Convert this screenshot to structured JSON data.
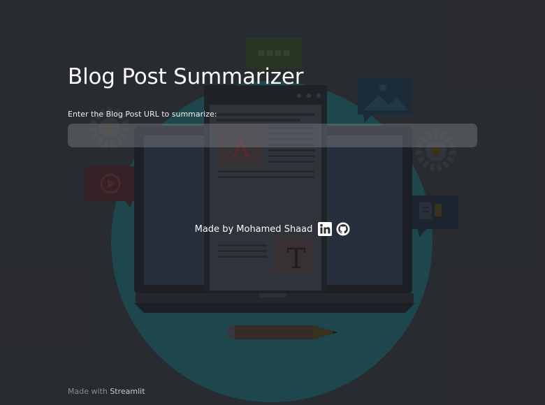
{
  "app": {
    "title": "Blog Post Summarizer",
    "input_label": "Enter the Blog Post URL to summarize:",
    "input_value": "",
    "input_placeholder": ""
  },
  "credit": {
    "text": "Made by Mohamed Shaad",
    "icons": [
      "linkedin-icon",
      "github-icon"
    ]
  },
  "footer": {
    "prefix": "Made with",
    "link": "Streamlit"
  },
  "background": {
    "letter_a": "A",
    "letter_t": "T",
    "colors": {
      "page": "#2a2c30",
      "circle": "#1d4f55",
      "laptop": "#1c1e24",
      "screen": "#262a33"
    }
  }
}
